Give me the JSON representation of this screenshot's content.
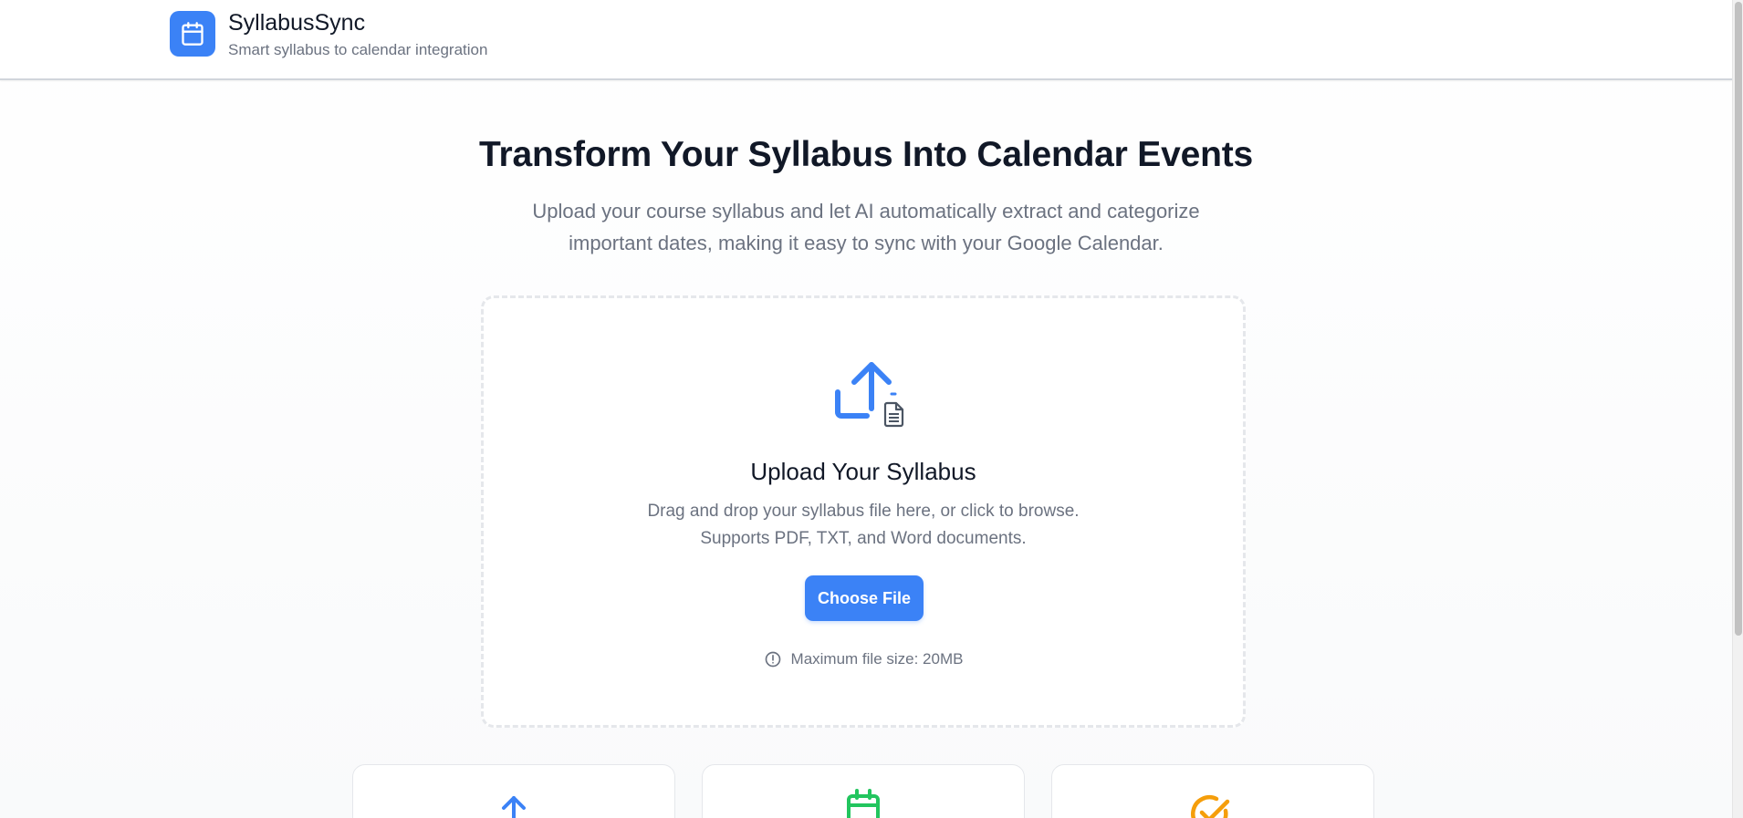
{
  "app": {
    "name": "SyllabusSync",
    "tagline": "Smart syllabus to calendar integration",
    "logo_icon": "calendar-icon",
    "accent_color": "#3b82f6"
  },
  "hero": {
    "title": "Transform Your Syllabus Into Calendar Events",
    "subtitle": "Upload your course syllabus and let AI automatically extract and categorize important dates, making it easy to sync with your Google Calendar."
  },
  "upload": {
    "icon": "file-upload-icon",
    "title": "Upload Your Syllabus",
    "description_line1": "Drag and drop your syllabus file here, or click to browse.",
    "description_line2": "Supports PDF, TXT, and Word documents.",
    "button_label": "Choose File",
    "note_icon": "info-circle-icon",
    "note": "Maximum file size: 20MB"
  },
  "features": [
    {
      "icon": "upload-arrow-icon",
      "color": "#3b82f6"
    },
    {
      "icon": "calendar-icon",
      "color": "#22c55e"
    },
    {
      "icon": "check-circle-icon",
      "color": "#f59e0b"
    }
  ]
}
